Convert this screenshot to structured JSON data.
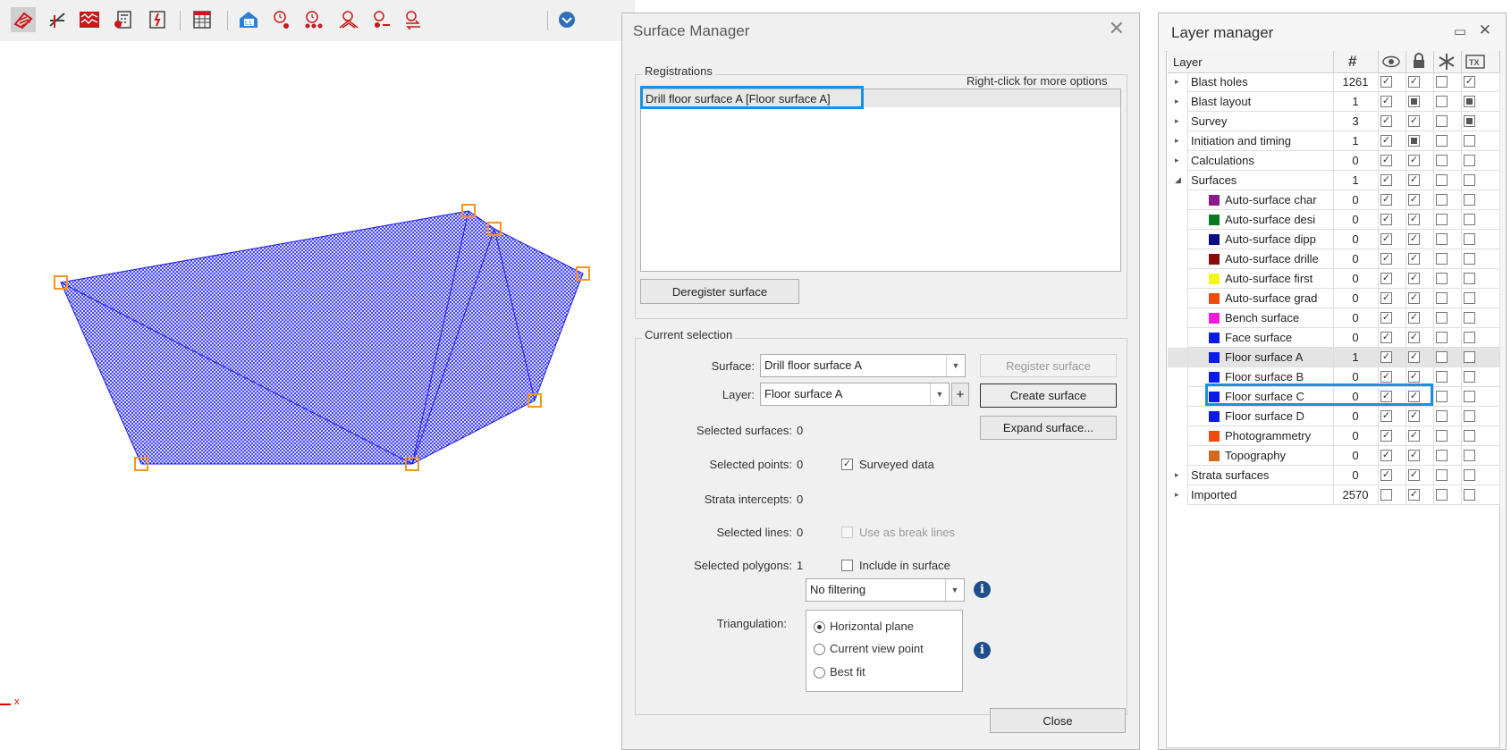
{
  "toolbar": {
    "icons": [
      "surface-icon",
      "profile-icon",
      "waveform-icon",
      "calculator-icon",
      "blast-symbol-icon",
      "table-icon",
      "level-icon",
      "timer-single-icon",
      "timer-group-icon",
      "timer-arrow-icon",
      "timer-minus-icon",
      "timer-swap-icon",
      "flag-icon"
    ]
  },
  "viewport": {
    "axis_label": "x",
    "surface_fill": "#2d2df5",
    "edge_color": "#1a1ae8",
    "vertex_color": "#f7941d"
  },
  "surface_manager": {
    "title": "Surface Manager",
    "registrations_label": "Registrations",
    "right_click_hint": "Right-click for more options",
    "registrations": [
      "Drill floor surface A [Floor surface A]"
    ],
    "deregister_button": "Deregister surface",
    "current_selection_label": "Current selection",
    "surface_label": "Surface:",
    "surface_value": "Drill floor surface A",
    "layer_label": "Layer:",
    "layer_value": "Floor surface A",
    "register_button": "Register surface",
    "create_button": "Create surface",
    "expand_button": "Expand surface...",
    "selected_surfaces_label": "Selected surfaces:",
    "selected_surfaces_value": "0",
    "selected_points_label": "Selected points:",
    "selected_points_value": "0",
    "surveyed_data_label": "Surveyed data",
    "strata_label": "Strata intercepts:",
    "strata_value": "0",
    "selected_lines_label": "Selected lines:",
    "selected_lines_value": "0",
    "break_lines_label": "Use as break lines",
    "selected_polygons_label": "Selected polygons:",
    "selected_polygons_value": "1",
    "include_label": "Include in surface",
    "filter_value": "No filtering",
    "triangulation_label": "Triangulation:",
    "triangulation_options": [
      "Horizontal plane",
      "Current view point",
      "Best fit"
    ],
    "close_button": "Close"
  },
  "layer_manager": {
    "title": "Layer manager",
    "header_layer": "Layer",
    "header_count": "#",
    "rows": [
      {
        "name": "Blast holes",
        "count": "1261",
        "indent": 0,
        "expander": "▸",
        "swatch": "",
        "vis": "check",
        "lock": "check",
        "freeze": "empty",
        "tx": "check"
      },
      {
        "name": "Blast layout",
        "count": "1",
        "indent": 0,
        "expander": "▸",
        "swatch": "",
        "vis": "check",
        "lock": "filled",
        "freeze": "empty",
        "tx": "filled"
      },
      {
        "name": "Survey",
        "count": "3",
        "indent": 0,
        "expander": "▸",
        "swatch": "",
        "vis": "check",
        "lock": "check",
        "freeze": "empty",
        "tx": "filled"
      },
      {
        "name": "Initiation and timing",
        "count": "1",
        "indent": 0,
        "expander": "▸",
        "swatch": "",
        "vis": "check",
        "lock": "filled",
        "freeze": "empty",
        "tx": "empty"
      },
      {
        "name": "Calculations",
        "count": "0",
        "indent": 0,
        "expander": "▸",
        "swatch": "",
        "vis": "check",
        "lock": "check",
        "freeze": "empty",
        "tx": "empty"
      },
      {
        "name": "Surfaces",
        "count": "1",
        "indent": 0,
        "expander": "◢",
        "swatch": "",
        "vis": "check",
        "lock": "check",
        "freeze": "empty",
        "tx": "empty"
      },
      {
        "name": "Auto-surface char",
        "count": "0",
        "indent": 1,
        "expander": "",
        "swatch": "#8b1a8b",
        "vis": "check",
        "lock": "check",
        "freeze": "empty",
        "tx": "empty"
      },
      {
        "name": "Auto-surface desi",
        "count": "0",
        "indent": 1,
        "expander": "",
        "swatch": "#0a7a1e",
        "vis": "check",
        "lock": "check",
        "freeze": "empty",
        "tx": "empty"
      },
      {
        "name": "Auto-surface dipp",
        "count": "0",
        "indent": 1,
        "expander": "",
        "swatch": "#0b0b8a",
        "vis": "check",
        "lock": "check",
        "freeze": "empty",
        "tx": "empty"
      },
      {
        "name": "Auto-surface drille",
        "count": "0",
        "indent": 1,
        "expander": "",
        "swatch": "#8b0a0a",
        "vis": "check",
        "lock": "check",
        "freeze": "empty",
        "tx": "empty"
      },
      {
        "name": "Auto-surface first",
        "count": "0",
        "indent": 1,
        "expander": "",
        "swatch": "#f5f51a",
        "vis": "check",
        "lock": "check",
        "freeze": "empty",
        "tx": "empty"
      },
      {
        "name": "Auto-surface grad",
        "count": "0",
        "indent": 1,
        "expander": "",
        "swatch": "#f04a0a",
        "vis": "check",
        "lock": "check",
        "freeze": "empty",
        "tx": "empty"
      },
      {
        "name": "Bench surface",
        "count": "0",
        "indent": 1,
        "expander": "",
        "swatch": "#f01ad8",
        "vis": "check",
        "lock": "check",
        "freeze": "empty",
        "tx": "empty"
      },
      {
        "name": "Face surface",
        "count": "0",
        "indent": 1,
        "expander": "",
        "swatch": "#0a1ae8",
        "vis": "check",
        "lock": "check",
        "freeze": "empty",
        "tx": "empty"
      },
      {
        "name": "Floor surface A",
        "count": "1",
        "indent": 1,
        "expander": "",
        "swatch": "#0a1ae8",
        "vis": "check",
        "lock": "check",
        "freeze": "empty",
        "tx": "empty",
        "selected": true
      },
      {
        "name": "Floor surface B",
        "count": "0",
        "indent": 1,
        "expander": "",
        "swatch": "#0a1ae8",
        "vis": "check",
        "lock": "check",
        "freeze": "empty",
        "tx": "empty"
      },
      {
        "name": "Floor surface C",
        "count": "0",
        "indent": 1,
        "expander": "",
        "swatch": "#0a1ae8",
        "vis": "check",
        "lock": "check",
        "freeze": "empty",
        "tx": "empty"
      },
      {
        "name": "Floor surface D",
        "count": "0",
        "indent": 1,
        "expander": "",
        "swatch": "#0a1ae8",
        "vis": "check",
        "lock": "check",
        "freeze": "empty",
        "tx": "empty"
      },
      {
        "name": "Photogrammetry",
        "count": "0",
        "indent": 1,
        "expander": "",
        "swatch": "#f04a0a",
        "vis": "check",
        "lock": "check",
        "freeze": "empty",
        "tx": "empty"
      },
      {
        "name": "Topography",
        "count": "0",
        "indent": 1,
        "expander": "",
        "swatch": "#d2691e",
        "vis": "check",
        "lock": "check",
        "freeze": "empty",
        "tx": "empty"
      },
      {
        "name": "Strata surfaces",
        "count": "0",
        "indent": 0,
        "expander": "▸",
        "swatch": "",
        "vis": "check",
        "lock": "check",
        "freeze": "empty",
        "tx": "empty"
      },
      {
        "name": "Imported",
        "count": "2570",
        "indent": 0,
        "expander": "▸",
        "swatch": "",
        "vis": "empty",
        "lock": "check",
        "freeze": "empty",
        "tx": "empty"
      }
    ]
  },
  "highlight_color": "#1a90e0"
}
